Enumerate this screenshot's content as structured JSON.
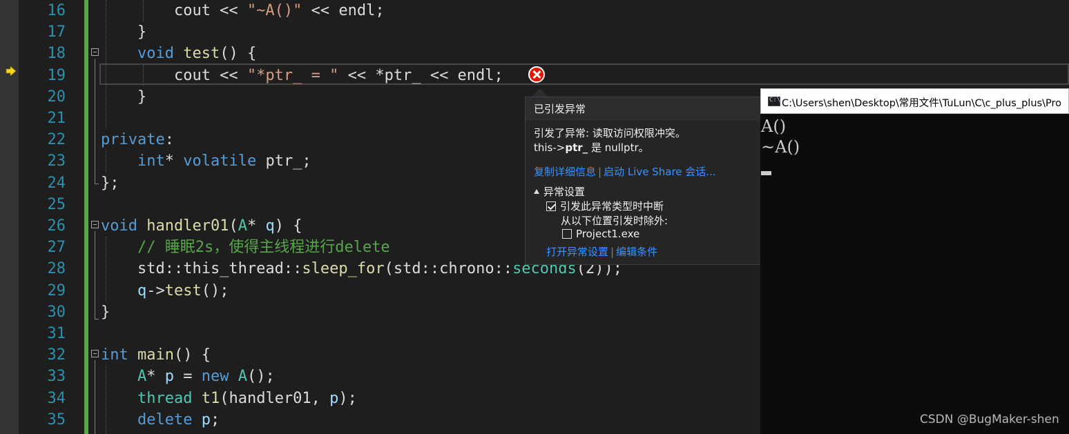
{
  "editor": {
    "line_numbers": [
      "16",
      "17",
      "18",
      "19",
      "20",
      "21",
      "22",
      "23",
      "24",
      "25",
      "26",
      "27",
      "28",
      "29",
      "30",
      "31",
      "32",
      "33",
      "34",
      "35"
    ],
    "current_line": "19"
  },
  "exception_popup": {
    "title": "已引发异常",
    "message_line1": "引发了异常: 读取访问权限冲突。",
    "message_line2_prefix": "this->",
    "message_line2_bold": "ptr_",
    "message_line2_suffix": " 是 nullptr。",
    "copy_details_link": "复制详细信息",
    "live_share_link": "启动 Live Share 会话...",
    "settings_header": "异常设置",
    "break_checkbox_label": "引发此异常类型时中断",
    "break_checkbox_checked": true,
    "except_label": "从以下位置引发时除外:",
    "project_checkbox_label": "Project1.exe",
    "project_checkbox_checked": false,
    "open_settings_link": "打开异常设置",
    "edit_conditions_link": "编辑条件"
  },
  "console": {
    "title": "C:\\Users\\shen\\Desktop\\常用文件\\TuLun\\C\\c_plus_plus\\Pro",
    "output_line1": "A()",
    "output_line2": "~A()"
  },
  "watermark": "CSDN @BugMaker-shen"
}
